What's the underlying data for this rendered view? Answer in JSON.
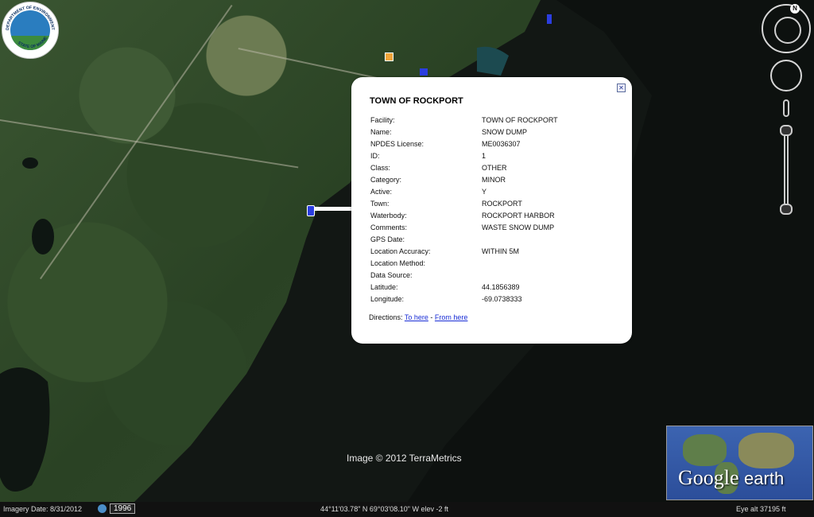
{
  "popup": {
    "title": "TOWN OF ROCKPORT",
    "rows": [
      {
        "k": "Facility:",
        "v": "TOWN OF ROCKPORT"
      },
      {
        "k": "Name:",
        "v": "SNOW DUMP"
      },
      {
        "k": "NPDES License:",
        "v": "ME0036307"
      },
      {
        "k": "ID:",
        "v": "1"
      },
      {
        "k": "Class:",
        "v": "OTHER"
      },
      {
        "k": "Category:",
        "v": "MINOR"
      },
      {
        "k": "Active:",
        "v": "Y"
      },
      {
        "k": "Town:",
        "v": "ROCKPORT"
      },
      {
        "k": "Waterbody:",
        "v": "ROCKPORT HARBOR"
      },
      {
        "k": "Comments:",
        "v": "WASTE SNOW DUMP"
      },
      {
        "k": "GPS Date:",
        "v": ""
      },
      {
        "k": "Location Accuracy:",
        "v": "WITHIN 5M"
      },
      {
        "k": "Location Method:",
        "v": ""
      },
      {
        "k": "Data Source:",
        "v": ""
      },
      {
        "k": "Latitude:",
        "v": "44.1856389"
      },
      {
        "k": "Longitude:",
        "v": "-69.0738333"
      }
    ],
    "directions_label": "Directions:",
    "to_here": "To here",
    "separator": "-",
    "from_here": "From here",
    "close_glyph": "✕"
  },
  "logo": {
    "top_text": "DEPARTMENT OF ENVIRONMENTAL PROTECTION",
    "bottom_text": "STATE OF MAINE"
  },
  "map": {
    "copyright": "Image © 2012 TerraMetrics"
  },
  "statusbar": {
    "imagery_date": "Imagery Date: 8/31/2012",
    "year": "1996",
    "coords": "44°11'03.78\" N  69°03'08.10\" W  elev   -2 ft",
    "eye_alt": "Eye alt   37195 ft"
  },
  "nav": {
    "north": "N"
  },
  "overview": {
    "brand_google": "Google",
    "brand_earth": "earth"
  },
  "colors": {
    "link": "#1a2ed6",
    "placemark": "#2b3ee0",
    "sea": "#0f1311"
  }
}
